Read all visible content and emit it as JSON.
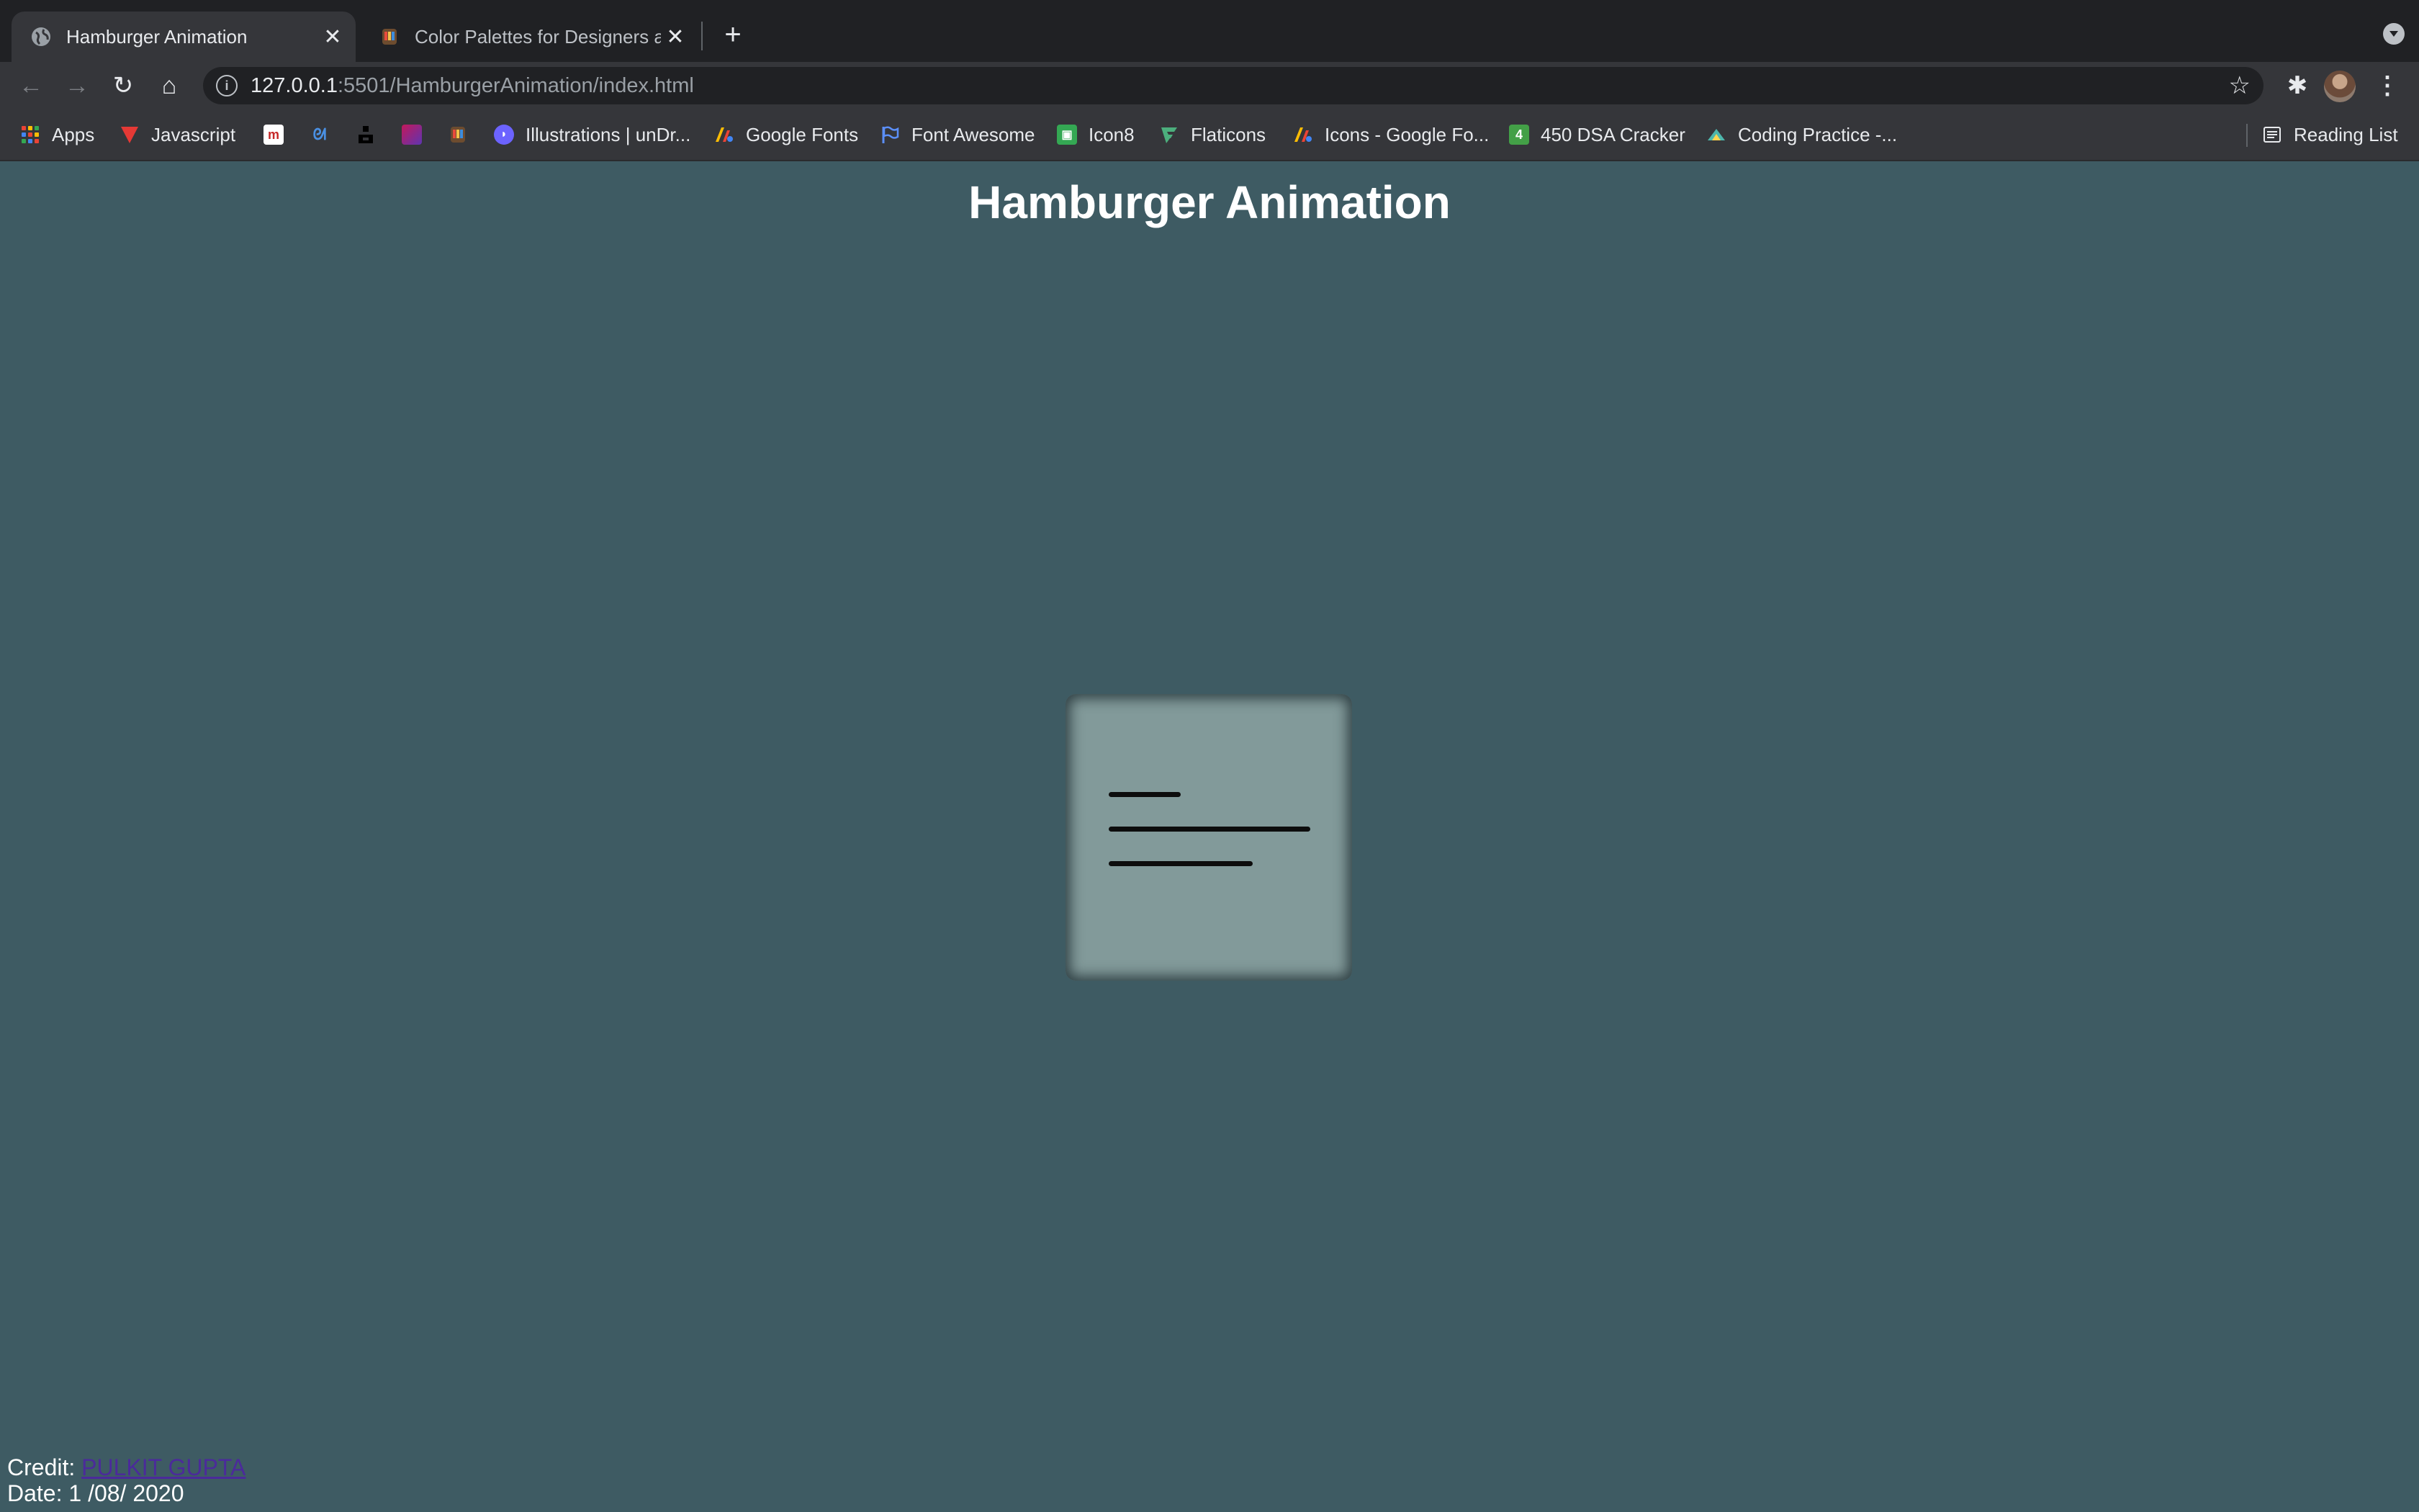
{
  "tabs": [
    {
      "title": "Hamburger Animation",
      "favicon": "globe-icon",
      "active": true
    },
    {
      "title": "Color Palettes for Designers and",
      "favicon": "color-palettes-icon",
      "active": false
    }
  ],
  "toolbar": {
    "url_host": "127.0.0.1",
    "url_rest": ":5501/HamburgerAnimation/index.html"
  },
  "bookmarks": [
    {
      "label": "Apps",
      "icon": "apps-grid-icon"
    },
    {
      "label": "Javascript",
      "icon": "javascript-v-icon"
    },
    {
      "label": "",
      "icon": "m-icon"
    },
    {
      "label": "",
      "icon": "blue-logo-icon"
    },
    {
      "label": "",
      "icon": "unsplash-icon"
    },
    {
      "label": "",
      "icon": "gradient-square-icon"
    },
    {
      "label": "",
      "icon": "color-palettes-icon"
    },
    {
      "label": "Illustrations | unDr...",
      "icon": "undraw-icon"
    },
    {
      "label": "Google Fonts",
      "icon": "google-fonts-icon"
    },
    {
      "label": "Font Awesome",
      "icon": "flag-icon"
    },
    {
      "label": "Icon8",
      "icon": "icon8-icon"
    },
    {
      "label": "Flaticons",
      "icon": "flaticon-icon"
    },
    {
      "label": "Icons - Google Fo...",
      "icon": "google-fonts-icon"
    },
    {
      "label": "450 DSA Cracker",
      "icon": "number-4-icon"
    },
    {
      "label": "Coding Practice -...",
      "icon": "coding-practice-icon"
    }
  ],
  "reading_list": {
    "label": "Reading List",
    "icon": "reading-list-icon"
  },
  "page": {
    "title": "Hamburger Animation",
    "credit_label": "Credit:",
    "credit_name": "PULKIT GUPTA",
    "date_text": "Date: 1 /08/ 2020"
  },
  "colors": {
    "page_background": "#3e5b63",
    "box_background": "#829a9a",
    "hamburger_lines": "#0d0d0d",
    "credit_link": "#4b2a9b"
  }
}
